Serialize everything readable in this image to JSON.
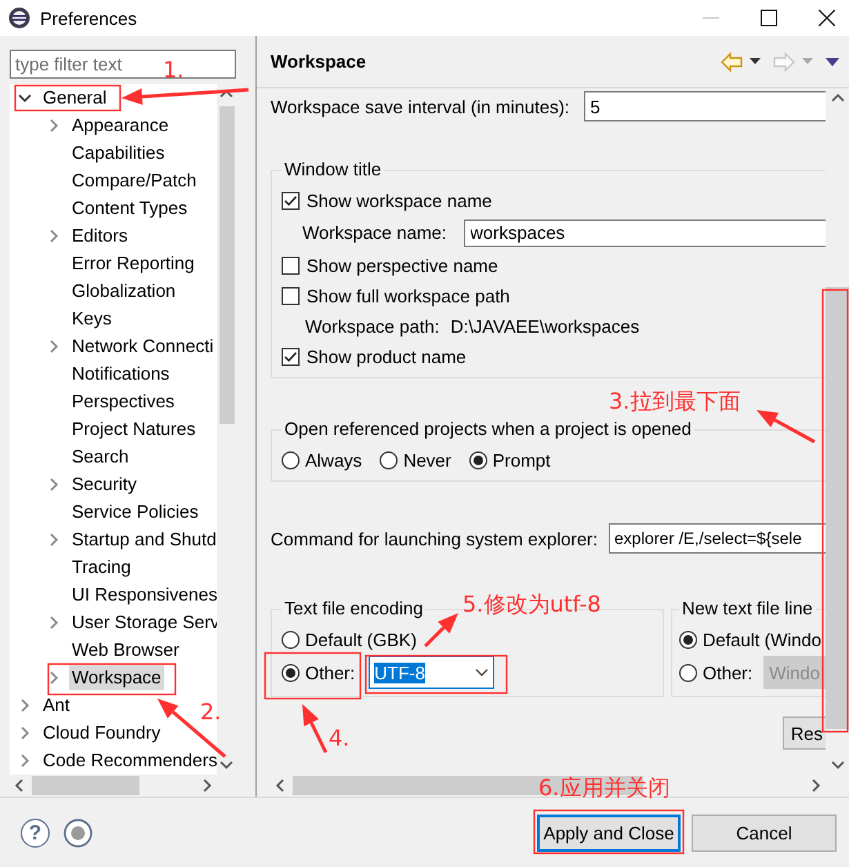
{
  "window": {
    "title": "Preferences"
  },
  "filter": {
    "placeholder": "type filter text"
  },
  "tree": [
    {
      "label": "General",
      "kind": "node",
      "expanded": true,
      "selected": false,
      "children": [
        {
          "label": "Appearance",
          "kind": "node",
          "expanded": false,
          "selected": false
        },
        {
          "label": "Capabilities",
          "kind": "leaf",
          "selected": false
        },
        {
          "label": "Compare/Patch",
          "kind": "leaf",
          "selected": false
        },
        {
          "label": "Content Types",
          "kind": "leaf",
          "selected": false
        },
        {
          "label": "Editors",
          "kind": "node",
          "expanded": false,
          "selected": false
        },
        {
          "label": "Error Reporting",
          "kind": "leaf",
          "selected": false
        },
        {
          "label": "Globalization",
          "kind": "leaf",
          "selected": false
        },
        {
          "label": "Keys",
          "kind": "leaf",
          "selected": false
        },
        {
          "label": "Network Connecti",
          "kind": "node",
          "expanded": false,
          "selected": false
        },
        {
          "label": "Notifications",
          "kind": "leaf",
          "selected": false
        },
        {
          "label": "Perspectives",
          "kind": "leaf",
          "selected": false
        },
        {
          "label": "Project Natures",
          "kind": "leaf",
          "selected": false
        },
        {
          "label": "Search",
          "kind": "leaf",
          "selected": false
        },
        {
          "label": "Security",
          "kind": "node",
          "expanded": false,
          "selected": false
        },
        {
          "label": "Service Policies",
          "kind": "leaf",
          "selected": false
        },
        {
          "label": "Startup and Shutd",
          "kind": "node",
          "expanded": false,
          "selected": false
        },
        {
          "label": "Tracing",
          "kind": "leaf",
          "selected": false
        },
        {
          "label": "UI Responsivenes",
          "kind": "leaf",
          "selected": false
        },
        {
          "label": "User Storage Serv",
          "kind": "node",
          "expanded": false,
          "selected": false
        },
        {
          "label": "Web Browser",
          "kind": "leaf",
          "selected": false
        },
        {
          "label": "Workspace",
          "kind": "node",
          "expanded": false,
          "selected": true
        }
      ]
    },
    {
      "label": "Ant",
      "kind": "node",
      "expanded": false,
      "selected": false
    },
    {
      "label": "Cloud Foundry",
      "kind": "node",
      "expanded": false,
      "selected": false
    },
    {
      "label": "Code Recommenders",
      "kind": "node",
      "expanded": false,
      "selected": false
    }
  ],
  "page": {
    "title": "Workspace"
  },
  "nav": [
    {
      "kind": "back",
      "disabled": false
    },
    {
      "kind": "forward",
      "disabled": true
    }
  ],
  "save_interval": {
    "label": "Workspace save interval (in minutes):",
    "value": "5"
  },
  "window_title_group": {
    "legend": "Window title",
    "rows": [
      {
        "kind": "checkbox",
        "label": "Show workspace name",
        "checked": true
      },
      {
        "kind": "field",
        "label": "Workspace name:",
        "value": "workspaces"
      },
      {
        "kind": "checkbox",
        "label": "Show perspective name",
        "checked": false
      },
      {
        "kind": "checkbox",
        "label": "Show full workspace path",
        "checked": false
      },
      {
        "kind": "info",
        "label": "Workspace path:",
        "value": "D:\\JAVAEE\\workspaces"
      },
      {
        "kind": "checkbox",
        "label": "Show product name",
        "checked": true
      }
    ]
  },
  "open_projects_group": {
    "legend": "Open referenced projects when a project is opened",
    "options": [
      {
        "label": "Always",
        "selected": false
      },
      {
        "label": "Never",
        "selected": false
      },
      {
        "label": "Prompt",
        "selected": true
      }
    ]
  },
  "explorer_command": {
    "label": "Command for launching system explorer:",
    "value": "explorer /E,/select=${sele"
  },
  "encoding_group": {
    "legend": "Text file encoding",
    "options": [
      {
        "label": "Default (GBK)",
        "selected": false
      },
      {
        "label": "Other:",
        "selected": true
      }
    ],
    "combo": {
      "value": "UTF-8",
      "disabled": false
    }
  },
  "line_delimiter_group": {
    "legend": "New text file line",
    "options": [
      {
        "label": "Default (Windo",
        "selected": true
      },
      {
        "label": "Other:",
        "selected": false
      }
    ],
    "combo": {
      "value": "Windo",
      "disabled": true
    }
  },
  "restore_button": "Res",
  "footer": {
    "help_button": "?",
    "buttons": [
      {
        "label": "Apply and Close",
        "kind": "primary"
      },
      {
        "label": "Cancel",
        "kind": "normal"
      }
    ]
  },
  "annotations": [
    {
      "text": "1."
    },
    {
      "text": "2."
    },
    {
      "text": "3.拉到最下面"
    },
    {
      "text": "4."
    },
    {
      "text": "5.修改为utf-8"
    },
    {
      "text": "6.应用并关闭"
    }
  ]
}
